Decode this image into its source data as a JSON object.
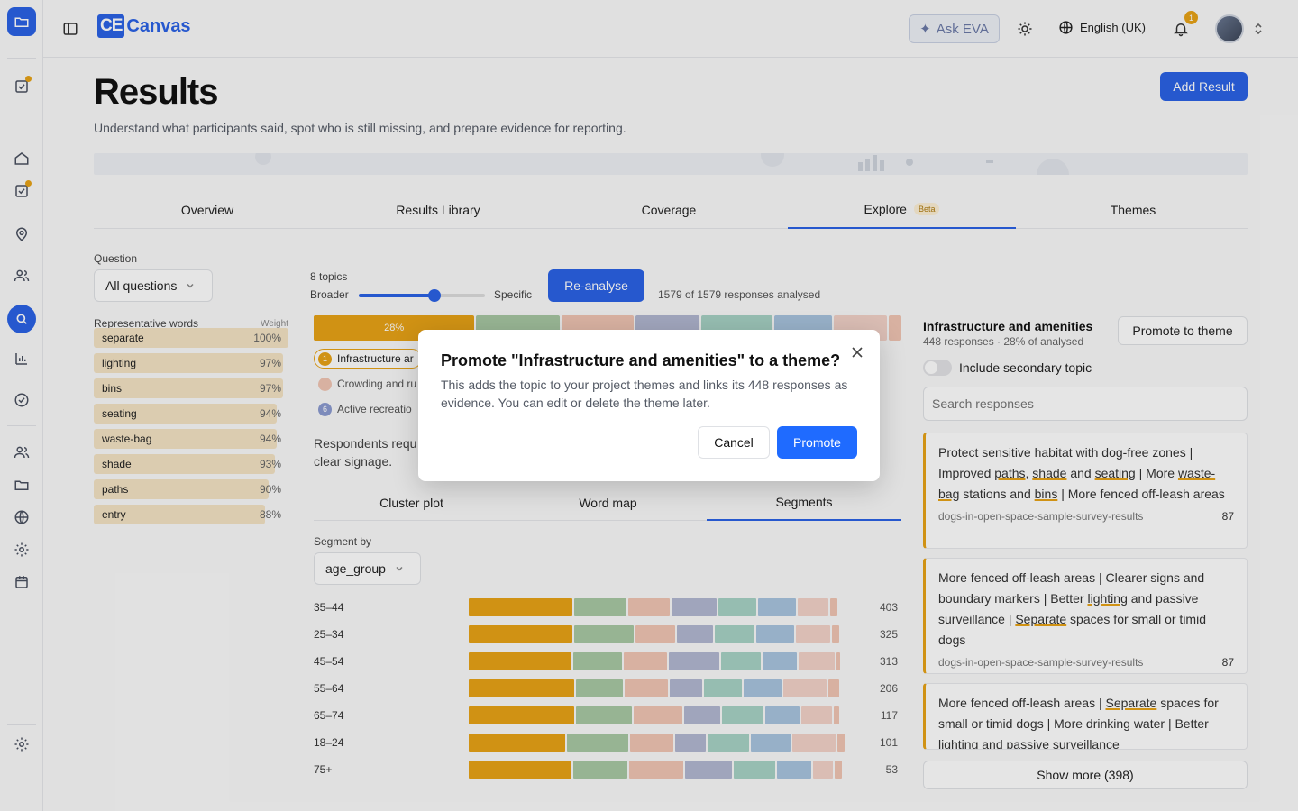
{
  "brand": {
    "ce": "CE",
    "name": "Canvas"
  },
  "topbar": {
    "ask_eva": "Ask EVA",
    "language": "English (UK)",
    "notifications": "1"
  },
  "page": {
    "title": "Results",
    "subtitle": "Understand what participants said, spot who is still missing, and prepare evidence for reporting.",
    "add_result": "Add Result"
  },
  "tabs": [
    {
      "label": "Overview"
    },
    {
      "label": "Results Library"
    },
    {
      "label": "Coverage"
    },
    {
      "label": "Explore",
      "badge": "Beta",
      "active": true
    },
    {
      "label": "Themes"
    }
  ],
  "filters": {
    "question_label": "Question",
    "question_value": "All questions",
    "words_label": "Representative words",
    "weight_label": "Weight",
    "words": [
      {
        "word": "separate",
        "pct": 100,
        "label": "100%"
      },
      {
        "word": "lighting",
        "pct": 97,
        "label": "97%"
      },
      {
        "word": "bins",
        "pct": 97,
        "label": "97%"
      },
      {
        "word": "seating",
        "pct": 94,
        "label": "94%"
      },
      {
        "word": "waste-bag",
        "pct": 94,
        "label": "94%"
      },
      {
        "word": "shade",
        "pct": 93,
        "label": "93%"
      },
      {
        "word": "paths",
        "pct": 90,
        "label": "90%"
      },
      {
        "word": "entry",
        "pct": 88,
        "label": "88%"
      }
    ]
  },
  "topics": {
    "count_label": "8 topics",
    "broader": "Broader",
    "specific": "Specific",
    "slider_value": 0.6,
    "reanalyse": "Re-analyse",
    "analysed": "1579 of 1579 responses analysed",
    "bar_first_label": "28%",
    "items": [
      {
        "num": "1",
        "label": "Infrastructure ar"
      },
      {
        "num": "",
        "label": "Crowding and ru"
      },
      {
        "num": "6",
        "label": "Active recreatio"
      }
    ],
    "summary": "Respondents requ clear signage."
  },
  "subtabs": [
    {
      "label": "Cluster plot"
    },
    {
      "label": "Word map"
    },
    {
      "label": "Segments",
      "active": true
    }
  ],
  "segments": {
    "label": "Segment by",
    "value": "age_group",
    "rows": [
      {
        "label": "35–44",
        "count": "403"
      },
      {
        "label": "25–34",
        "count": "325"
      },
      {
        "label": "45–54",
        "count": "313"
      },
      {
        "label": "55–64",
        "count": "206"
      },
      {
        "label": "65–74",
        "count": "117"
      },
      {
        "label": "18–24",
        "count": "101"
      },
      {
        "label": "75+",
        "count": "53"
      }
    ]
  },
  "panel": {
    "title": "Infrastructure and amenities",
    "subtitle": "448 responses · 28% of analysed",
    "promote_button": "Promote to theme",
    "toggle_label": "Include secondary topic",
    "search_placeholder": "Search responses",
    "cards": [
      {
        "source": "dogs-in-open-space-sample-survey-results",
        "score": "87"
      },
      {
        "source": "dogs-in-open-space-sample-survey-results",
        "score": "87"
      }
    ],
    "show_more": "Show more (398)"
  },
  "modal": {
    "title": "Promote \"Infrastructure and amenities\" to a theme?",
    "body": "This adds the topic to your project themes and links its 448 responses as evidence. You can edit or delete the theme later.",
    "cancel": "Cancel",
    "promote": "Promote"
  },
  "colors": {
    "accent": "#2b63e6",
    "topic1": "#e8a317",
    "topic2": "#a9c9a4",
    "topic3": "#f1c6b4",
    "topic4": "#b3b8d2",
    "topic5": "#a8d3c6",
    "topic6": "#a9c4df",
    "topic7": "#f3d3c9"
  }
}
